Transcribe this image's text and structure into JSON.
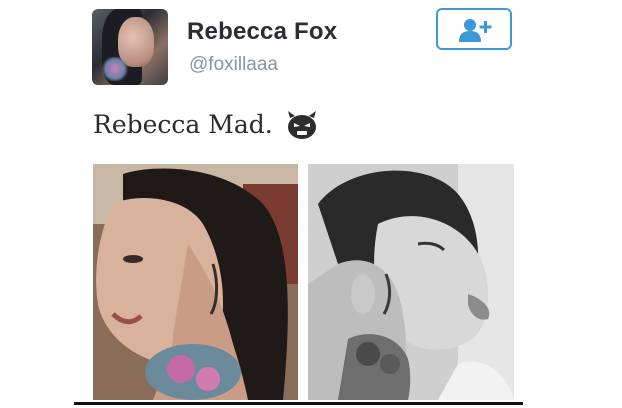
{
  "user": {
    "name": "Rebecca Fox",
    "handle": "@foxillaaa",
    "avatar_alt": ""
  },
  "follow_button": {
    "icon": "add-user-icon",
    "color": "#3c98d8"
  },
  "tweet": {
    "text": "Rebecca Mad.",
    "emoji_icon": "angry-face-emoji-icon"
  },
  "media": [
    {
      "name": "photo-left",
      "tone": "color"
    },
    {
      "name": "photo-right",
      "tone": "grayscale"
    }
  ]
}
